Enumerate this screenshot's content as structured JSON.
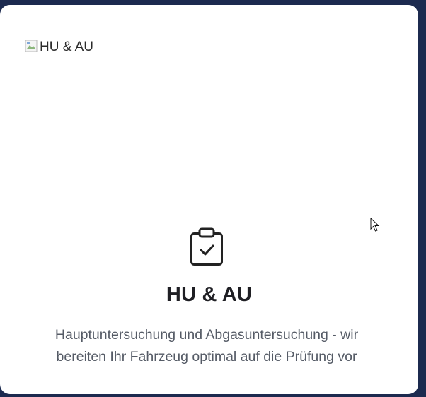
{
  "card": {
    "image_alt": "HU & AU",
    "icon": "clipboard-check-icon",
    "title": "HU & AU",
    "description": "Hauptuntersuchung und Abgasuntersuchung - wir bereiten Ihr Fahrzeug optimal auf die Prüfung vor"
  },
  "colors": {
    "background": "#1c2a4f",
    "card": "#ffffff",
    "title": "#1f1f24",
    "text": "#555b66"
  }
}
